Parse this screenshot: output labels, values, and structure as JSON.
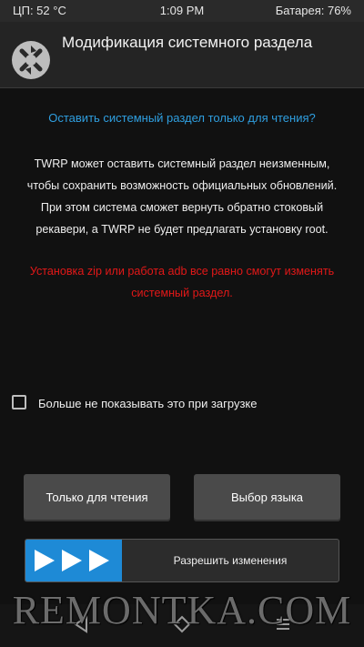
{
  "status_bar": {
    "cpu": "ЦП: 52 °C",
    "time": "1:09 PM",
    "battery": "Батарея: 76%"
  },
  "header": {
    "title": "Модификация системного раздела",
    "logo_icon": "twrp-logo-icon"
  },
  "dialog": {
    "question": "Оставить системный раздел только для чтения?",
    "body_lines": [
      "TWRP может оставить системный раздел неизменным,",
      "чтобы сохранить возможность официальных обновлений.",
      "При этом система сможет вернуть обратно стоковый",
      "рекавери, а TWRP не будет предлагать установку root."
    ],
    "warning_lines": [
      "Установка zip или работа adb все равно смогут изменять",
      "системный раздел."
    ]
  },
  "checkbox": {
    "label": "Больше не показывать это при загрузке",
    "checked": false
  },
  "buttons": {
    "read_only": "Только для чтения",
    "language": "Выбор языка"
  },
  "swipe": {
    "label": "Разрешить изменения",
    "handle_icon": "triple-arrow-right-icon"
  },
  "nav": {
    "back_icon": "back-icon",
    "home_icon": "home-icon",
    "menu_icon": "menu-icon"
  },
  "watermark": "REMONTKA.COM",
  "colors": {
    "accent_blue": "#2f9fe0",
    "warning_red": "#e21818",
    "swipe_blue": "#1e8ad6",
    "button_gray": "#4a4a4a"
  }
}
